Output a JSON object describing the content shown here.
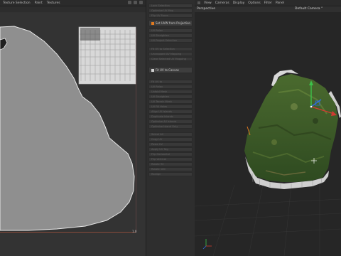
{
  "uv_editor": {
    "menu": [
      "Texture Selection",
      "Paint",
      "Textures"
    ],
    "axis_label": "1.0"
  },
  "tool_panel": {
    "buttons": [
      "Lock Selection",
      "Optimize UV Map",
      "Flip UV Faces",
      "Set UVW from Projection",
      "UV Relax",
      "UV Straighten",
      "UV Project Selection",
      "Fit UV to Selection",
      "Uncropped UV Mapping",
      "Clear Selected UV Mapping",
      "Fit UV to Canvas",
      "Fit UV to",
      "UV Relax",
      "Unfold Mesh",
      "UV Straighten",
      "UV Terrain Mesh",
      "UV Fill Holes",
      "Align UV Islands",
      "Duplicate Islands",
      "Optimize All Islands",
      "Optimize Island Only",
      "Select All",
      "Copy UV",
      "Paste UV",
      "Apply UV Tag",
      "Flip Horizontal",
      "Flip Vertical",
      "Rotate 90",
      "Rotate 180",
      "Realign"
    ]
  },
  "viewport": {
    "menu": [
      "View",
      "Cameras",
      "Display",
      "Options",
      "Filter",
      "Panel"
    ],
    "label_left": "Perspective",
    "label_right": "Default Camera °"
  },
  "colors": {
    "accent_orange": "#e07a20",
    "axis_x": "#d23a32",
    "axis_y": "#3cc24a",
    "axis_z": "#2f6fe0"
  }
}
